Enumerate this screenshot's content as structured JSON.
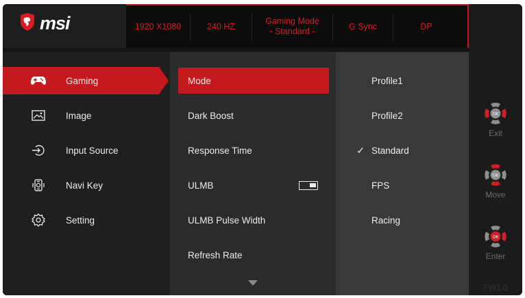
{
  "brand": {
    "name": "msi",
    "logo_icon": "dragon-shield-icon",
    "accent": "#c41a1f"
  },
  "header": {
    "items": [
      {
        "line1": "1920 X1080",
        "line2": ""
      },
      {
        "line1": "240 HZ",
        "line2": ""
      },
      {
        "line1": "Gaming Mode",
        "line2": "- Standard -"
      },
      {
        "line1": "G Sync",
        "line2": ""
      },
      {
        "line1": "DP",
        "line2": ""
      }
    ]
  },
  "menu": [
    {
      "label": "Gaming",
      "icon": "gamepad-icon",
      "active": true
    },
    {
      "label": "Image",
      "icon": "image-icon",
      "active": false
    },
    {
      "label": "Input Source",
      "icon": "input-source-icon",
      "active": false
    },
    {
      "label": "Navi Key",
      "icon": "navi-key-icon",
      "active": false
    },
    {
      "label": "Setting",
      "icon": "gear-icon",
      "active": false
    }
  ],
  "submenu": [
    {
      "label": "Mode",
      "active": true
    },
    {
      "label": "Dark Boost",
      "active": false
    },
    {
      "label": "Response Time",
      "active": false
    },
    {
      "label": "ULMB",
      "active": false,
      "toggle": "on"
    },
    {
      "label": "ULMB Pulse Width",
      "active": false
    },
    {
      "label": "Refresh Rate",
      "active": false
    }
  ],
  "options": [
    {
      "label": "Profile1",
      "selected": false
    },
    {
      "label": "Profile2",
      "selected": false
    },
    {
      "label": "Standard",
      "selected": true
    },
    {
      "label": "FPS",
      "selected": false
    },
    {
      "label": "Racing",
      "selected": false
    }
  ],
  "check_glyph": "✓",
  "controls": [
    {
      "label": "Exit",
      "icon": "exit-joystick-icon"
    },
    {
      "label": "Move",
      "icon": "move-joystick-icon"
    },
    {
      "label": "Enter",
      "icon": "enter-joystick-icon"
    }
  ],
  "firmware": "FW1.0"
}
